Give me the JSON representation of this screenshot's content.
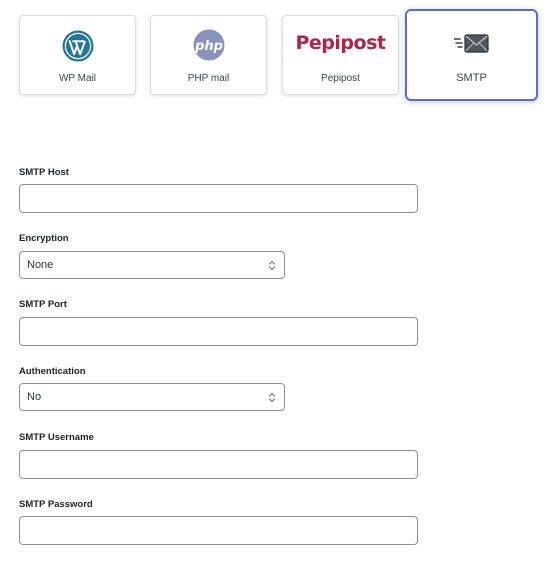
{
  "mailers": [
    {
      "id": "wpmail",
      "label": "WP Mail",
      "icon": "wordpress-icon",
      "selected": false
    },
    {
      "id": "phpmail",
      "label": "PHP mail",
      "icon": "php-icon",
      "selected": false
    },
    {
      "id": "pepipost",
      "label": "Pepipost",
      "logo_text": "Pepipost",
      "icon": "pepipost-logo",
      "selected": false
    },
    {
      "id": "smtp",
      "label": "SMTP",
      "icon": "envelope-icon",
      "selected": true
    }
  ],
  "form": {
    "host": {
      "label": "SMTP Host",
      "value": ""
    },
    "encryption": {
      "label": "Encryption",
      "value": "None"
    },
    "port": {
      "label": "SMTP Port",
      "value": ""
    },
    "authentication": {
      "label": "Authentication",
      "value": "No"
    },
    "username": {
      "label": "SMTP Username",
      "value": ""
    },
    "password": {
      "label": "SMTP Password",
      "value": ""
    }
  },
  "colors": {
    "accent": "#5c6ad2",
    "wordpress": "#21759b",
    "php": "#8892bf",
    "pepipost": "#b2224a",
    "input_border": "#8c8f94"
  }
}
